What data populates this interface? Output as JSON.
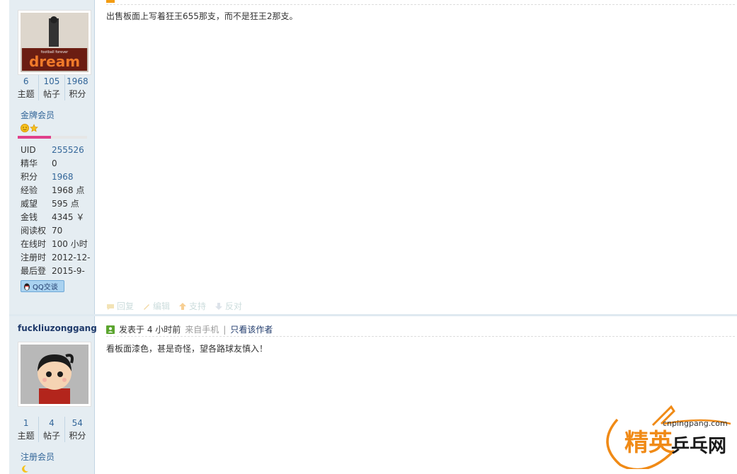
{
  "post1": {
    "stats": [
      {
        "num": "6",
        "label": "主题"
      },
      {
        "num": "105",
        "label": "帖子"
      },
      {
        "num": "1968",
        "label": "积分"
      }
    ],
    "avatar_text": "dream",
    "rank": "金牌会员",
    "profile": [
      {
        "k": "UID",
        "v": "255526",
        "link": true
      },
      {
        "k": "精华",
        "v": "0",
        "link": false
      },
      {
        "k": "积分",
        "v": "1968",
        "link": true
      },
      {
        "k": "经验",
        "v": "1968 点",
        "link": false
      },
      {
        "k": "威望",
        "v": "595 点",
        "link": false
      },
      {
        "k": "金钱",
        "v": "4345 ￥",
        "link": false
      },
      {
        "k": "阅读权",
        "v": "70",
        "link": false
      },
      {
        "k": "在线时",
        "v": "100 小时",
        "link": false
      },
      {
        "k": "注册时",
        "v": "2012-12-",
        "link": false
      },
      {
        "k": "最后登",
        "v": "2015-9-",
        "link": false
      }
    ],
    "qq_label": "QQ交谈",
    "content": "出售板面上写着狂王655那支，而不是狂王2那支。",
    "actions": [
      "回复",
      "编辑",
      "支持",
      "反对"
    ]
  },
  "post2": {
    "username": "fuckliuzonggang",
    "meta_posted": "发表于 4 小时前",
    "meta_source": "来自手机",
    "meta_sep": "|",
    "meta_author_only": "只看该作者",
    "content": "看板面漆色，甚是奇怪，望各路球友慎入！",
    "stats": [
      {
        "num": "1",
        "label": "主题"
      },
      {
        "num": "4",
        "label": "帖子"
      },
      {
        "num": "54",
        "label": "积分"
      }
    ],
    "rank": "注册会员"
  },
  "watermark": {
    "domain": "cnpingpang.com",
    "name_part1": "精英",
    "name_part2": "乒乓网"
  }
}
